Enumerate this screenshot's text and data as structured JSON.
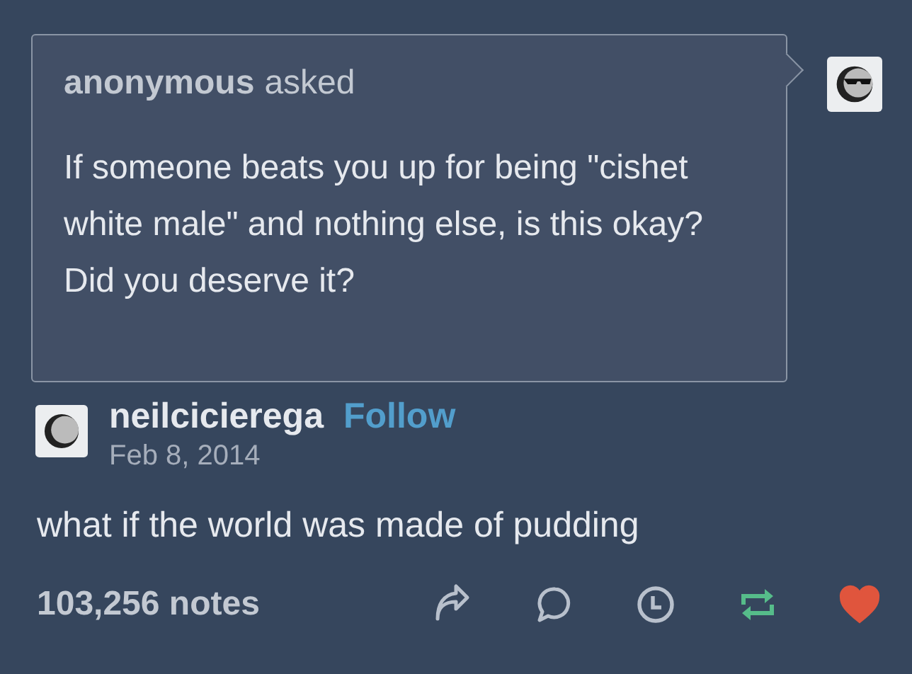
{
  "ask": {
    "asker": "anonymous",
    "verb": "asked",
    "question": "If someone beats you up for being \"cishet white male\" and nothing else, is this okay? Did you deserve it?"
  },
  "answer": {
    "username": "neilcicierega",
    "follow": "Follow",
    "date": "Feb 8, 2014",
    "body": "what if the world was made of pudding"
  },
  "footer": {
    "notes": "103,256 notes",
    "reblogged": true,
    "liked": true
  }
}
